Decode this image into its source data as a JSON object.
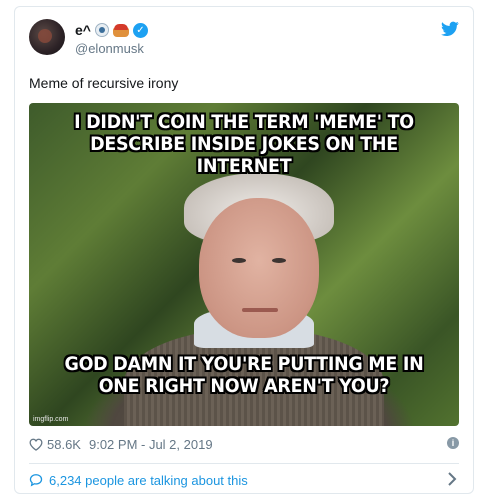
{
  "tweet": {
    "display_name": "e^",
    "handle": "@elonmusk",
    "text": "Meme of recursive irony",
    "verified": true,
    "icons": [
      "eye-emoji-icon",
      "pie-emoji-icon",
      "verified-icon",
      "twitter-bird-icon"
    ]
  },
  "meme": {
    "top_caption": "I DIDN'T COIN THE TERM 'MEME' TO DESCRIBE INSIDE JOKES ON THE INTERNET",
    "bottom_caption": "GOD DAMN IT YOU'RE PUTTING ME IN ONE RIGHT NOW AREN'T YOU?",
    "watermark": "imgflip.com"
  },
  "meta": {
    "likes": "58.6K",
    "timestamp": "9:02 PM - Jul 2, 2019"
  },
  "conversation": {
    "label": "6,234 people are talking about this"
  },
  "colors": {
    "accent": "#1da1f2",
    "link": "#1b95e0",
    "muted": "#657786",
    "border": "#e1e8ed"
  }
}
